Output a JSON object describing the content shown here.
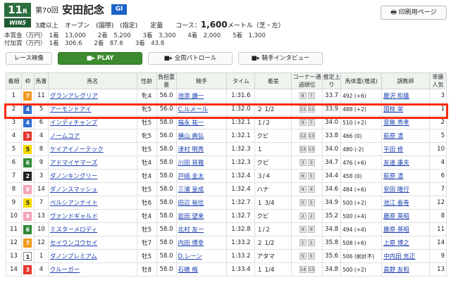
{
  "race": {
    "number": "11",
    "suffix": "R",
    "win5": "WIN5",
    "num_label": "第70回",
    "name": "安田記念",
    "grade": "GI",
    "conditions_pre": "3歳以上　オープン　(国際)　(指定)　　定量　　コース：",
    "distance": "1,600",
    "conditions_post": "メートル（芝・左）"
  },
  "print_button": "印刷用ページ",
  "prize": {
    "main": "本賞金（万円）　1着　13,000　　2着　5,200　　3着　3,300　　4着　2,000　　5着　1,300",
    "added": "付加賞（万円）　1着　306.6　　2着　87.6　　3着　43.8"
  },
  "buttons": {
    "video": "レース映像",
    "play": "PLAY",
    "patrol": "全周パトロール",
    "interview": "騎手インタビュー"
  },
  "columns": [
    "着順",
    "枠",
    "馬番",
    "馬名",
    "性齢",
    "負担重量",
    "騎手",
    "タイム",
    "着差",
    "コーナー通過順位",
    "推定上り",
    "馬体重(増減)",
    "調教師",
    "単勝人気"
  ],
  "colors": {
    "waku1": "#ffffff",
    "waku2": "#222222",
    "waku3": "#e8352e",
    "waku4": "#2f6fd1",
    "waku5": "#f5d800",
    "waku6": "#2e8a3a",
    "waku7": "#f39a1e",
    "waku8": "#f4a3b8",
    "highlight": "#ff2a0a",
    "play": "#3c8a2e"
  },
  "rows": [
    {
      "rank": "1",
      "waku": "7",
      "num": "11",
      "horse": "グランアレグリア",
      "sex": "牝4",
      "wt": "56.0",
      "jockey": "池添 謙一",
      "time": "1:31.6",
      "margin": "",
      "c1": "8",
      "c2": "7",
      "agari": "33.7",
      "bw": "492 (+6)",
      "trainer": "藤沢 和雄",
      "pop": "3"
    },
    {
      "rank": "2",
      "waku": "4",
      "num": "5",
      "horse": "アーモンドアイ",
      "sex": "牝5",
      "wt": "56.0",
      "jockey": "C.ルメール",
      "time": "1:32.0",
      "margin": "２ 1/2",
      "c1": "11",
      "c2": "11",
      "agari": "33.9",
      "bw": "488 (+2)",
      "trainer": "国枝 栄",
      "pop": "1"
    },
    {
      "rank": "3",
      "waku": "4",
      "num": "6",
      "horse": "インディチャンプ",
      "sex": "牡5",
      "wt": "58.0",
      "jockey": "福永 祐一",
      "time": "1:32.1",
      "margin": "１/２",
      "c1": "9",
      "c2": "7",
      "agari": "34.0",
      "bw": "510 (+2)",
      "trainer": "音無 秀孝",
      "pop": "2"
    },
    {
      "rank": "4",
      "waku": "3",
      "num": "4",
      "horse": "ノームコア",
      "sex": "牝5",
      "wt": "56.0",
      "jockey": "横山 典弘",
      "time": "1:32.1",
      "margin": "クビ",
      "c1": "12",
      "c2": "13",
      "agari": "33.8",
      "bw": "466 (0)",
      "trainer": "萩原 清",
      "pop": "5"
    },
    {
      "rank": "5",
      "waku": "5",
      "num": "8",
      "horse": "ケイアイノーテック",
      "sex": "牡5",
      "wt": "58.0",
      "jockey": "津村 明秀",
      "time": "1:32.3",
      "margin": "１",
      "c1": "13",
      "c2": "13",
      "agari": "34.0",
      "bw": "480 (-2)",
      "trainer": "平田 修",
      "pop": "10"
    },
    {
      "rank": "6",
      "waku": "6",
      "num": "9",
      "horse": "アドマイヤマーズ",
      "sex": "牡4",
      "wt": "58.0",
      "jockey": "川田 将雅",
      "time": "1:32.3",
      "margin": "クビ",
      "c1": "3",
      "c2": "3",
      "agari": "34.7",
      "bw": "476 (+6)",
      "trainer": "友道 康夫",
      "pop": "4"
    },
    {
      "rank": "7",
      "waku": "2",
      "num": "3",
      "horse": "ダノンキングリー",
      "sex": "牡4",
      "wt": "58.0",
      "jockey": "戸崎 圭太",
      "time": "1:32.4",
      "margin": "３/４",
      "c1": "6",
      "c2": "5",
      "agari": "34.4",
      "bw": "458 (0)",
      "trainer": "萩原 清",
      "pop": "6"
    },
    {
      "rank": "8",
      "waku": "8",
      "num": "14",
      "horse": "ダノンスマッシュ",
      "sex": "牡5",
      "wt": "58.0",
      "jockey": "三浦 皇成",
      "time": "1:32.4",
      "margin": "ハナ",
      "c1": "4",
      "c2": "4",
      "agari": "34.6",
      "bw": "484 (+6)",
      "trainer": "安田 隆行",
      "pop": "7"
    },
    {
      "rank": "9",
      "waku": "5",
      "num": "7",
      "horse": "ペルシアンナイト",
      "sex": "牡6",
      "wt": "58.0",
      "jockey": "田辺 裕信",
      "time": "1:32.7",
      "margin": "１ 3/4",
      "c1": "5",
      "c2": "5",
      "agari": "34.9",
      "bw": "500 (+2)",
      "trainer": "池江 泰寿",
      "pop": "12"
    },
    {
      "rank": "10",
      "waku": "8",
      "num": "13",
      "horse": "ヴァンドギャルド",
      "sex": "牡4",
      "wt": "58.0",
      "jockey": "岩田 望来",
      "time": "1:32.7",
      "margin": "クビ",
      "c1": "2",
      "c2": "2",
      "agari": "35.2",
      "bw": "500 (+4)",
      "trainer": "藤原 英昭",
      "pop": "8"
    },
    {
      "rank": "11",
      "waku": "6",
      "num": "10",
      "horse": "ミスターメロディ",
      "sex": "牡5",
      "wt": "58.0",
      "jockey": "北村 友一",
      "time": "1:32.8",
      "margin": "１/２",
      "c1": "9",
      "c2": "9",
      "agari": "34.8",
      "bw": "494 (+4)",
      "trainer": "藤原 英昭",
      "pop": "11"
    },
    {
      "rank": "12",
      "waku": "7",
      "num": "12",
      "horse": "セイウンコウセイ",
      "sex": "牡7",
      "wt": "58.0",
      "jockey": "内田 博幸",
      "time": "1:33.2",
      "margin": "２ 1/2",
      "c1": "1",
      "c2": "1",
      "agari": "35.8",
      "bw": "508 (+6)",
      "trainer": "上原 博之",
      "pop": "14"
    },
    {
      "rank": "13",
      "waku": "1",
      "num": "1",
      "horse": "ダノンプレミアム",
      "sex": "牡5",
      "wt": "58.0",
      "jockey": "D.レーン",
      "time": "1:33.2",
      "margin": "アタマ",
      "c1": "5",
      "c2": "5",
      "agari": "35.6",
      "bw": "506 (前計不)",
      "trainer": "中内田 充正",
      "pop": "9"
    },
    {
      "rank": "14",
      "waku": "3",
      "num": "4",
      "horse": "クルーガー",
      "sex": "牡8",
      "wt": "58.0",
      "jockey": "石橋 脩",
      "time": "1:33.4",
      "margin": "１ 1/4",
      "c1": "14",
      "c2": "13",
      "agari": "34.8",
      "bw": "500 (+2)",
      "trainer": "高野 友和",
      "pop": "13"
    }
  ]
}
